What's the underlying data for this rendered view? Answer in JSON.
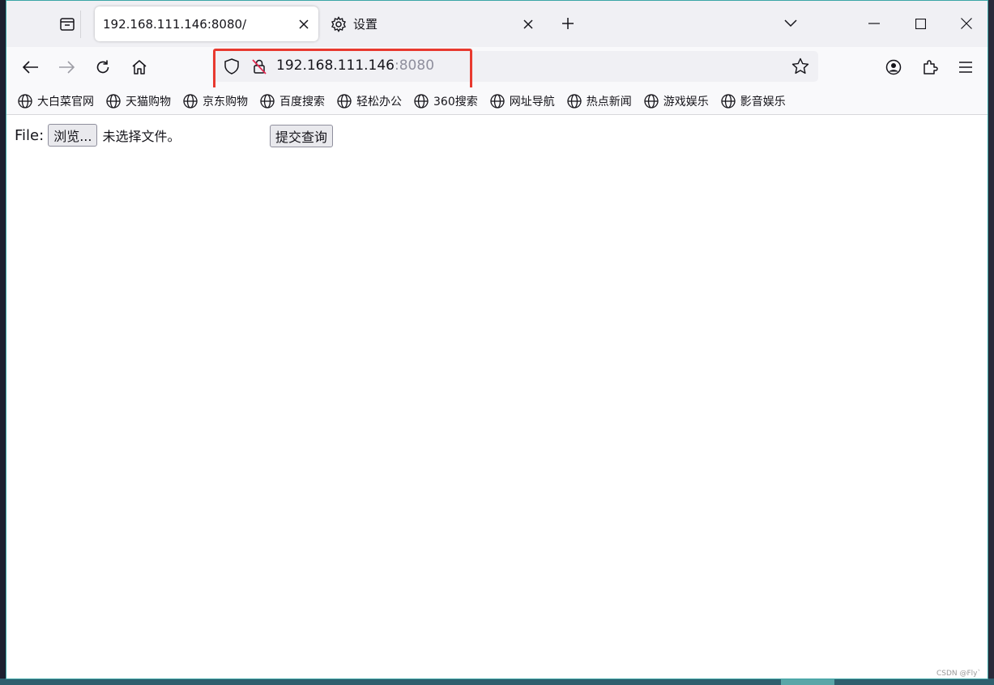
{
  "tabs": [
    {
      "title": "192.168.111.146:8080/",
      "active": true
    },
    {
      "title": "设置",
      "active": false
    }
  ],
  "address": {
    "host": "192.168.111.146",
    "port": ":8080"
  },
  "bookmarks": [
    "大白菜官网",
    "天猫购物",
    "京东购物",
    "百度搜索",
    "轻松办公",
    "360搜索",
    "网址导航",
    "热点新闻",
    "游戏娱乐",
    "影音娱乐"
  ],
  "form": {
    "file_label": "File:",
    "browse_button": "浏览...",
    "no_file_text": "未选择文件。",
    "submit_button": "提交查询"
  },
  "watermark": "CSDN @Fly`",
  "colors": {
    "highlight": "#e8392f",
    "window_border": "#3ba6a6"
  }
}
